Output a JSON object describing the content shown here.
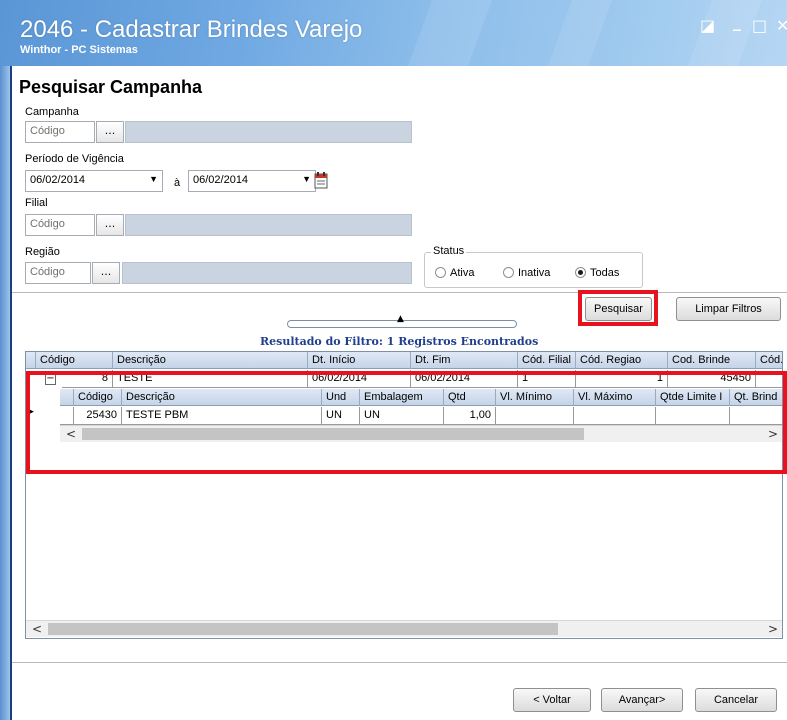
{
  "window": {
    "title": "2046 - Cadastrar Brindes Varejo",
    "subtitle": "Winthor - PC Sistemas",
    "restore_glyph": "◪",
    "minimize_glyph": "_",
    "maximize_glyph": "□",
    "close_glyph": "✕"
  },
  "heading": "Pesquisar Campanha",
  "campanha": {
    "label": "Campanha",
    "placeholder": "Código",
    "button": "..."
  },
  "periodo": {
    "label": "Período de Vigência",
    "from": "06/02/2014",
    "separator": "à",
    "to": "06/02/2014"
  },
  "filial": {
    "label": "Filial",
    "placeholder": "Código",
    "button": "..."
  },
  "regiao": {
    "label": "Região",
    "placeholder": "Código",
    "button": "..."
  },
  "status": {
    "legend": "Status",
    "options": [
      "Ativa",
      "Inativa",
      "Todas"
    ],
    "selected": "Todas"
  },
  "buttons": {
    "pesquisar": "Pesquisar",
    "limpar": "Limpar Filtros"
  },
  "result_title": "Resultado do Filtro: 1 Registros Encontrados",
  "grid": {
    "columns": [
      "Código",
      "Descrição",
      "Dt. Início",
      "Dt. Fim",
      "Cód. Filial",
      "Cód. Regiao",
      "Cod. Brinde",
      "Cód."
    ],
    "row": {
      "codigo": "8",
      "descricao": "TESTE",
      "dt_inicio": "06/02/2014",
      "dt_fim": "06/02/2014",
      "cod_filial": "1",
      "cod_regiao": "1",
      "cod_brinde": "45450"
    },
    "detail_columns": [
      "Código",
      "Descrição",
      "Und",
      "Embalagem",
      "Qtd",
      "Vl. Mínimo",
      "Vl. Máximo",
      "Qtde Limite I",
      "Qt. Brind"
    ],
    "detail_row": {
      "codigo": "25430",
      "descricao": "TESTE PBM",
      "und": "UN",
      "embalagem": "UN",
      "qtd": "1,00"
    }
  },
  "footer": {
    "voltar": "< Voltar",
    "avancar": "Avançar>",
    "cancelar": "Cancelar"
  },
  "colors": {
    "highlight": "#e8121e",
    "title_bar": "#6fa8e2",
    "result_title": "#1f3f8c"
  }
}
